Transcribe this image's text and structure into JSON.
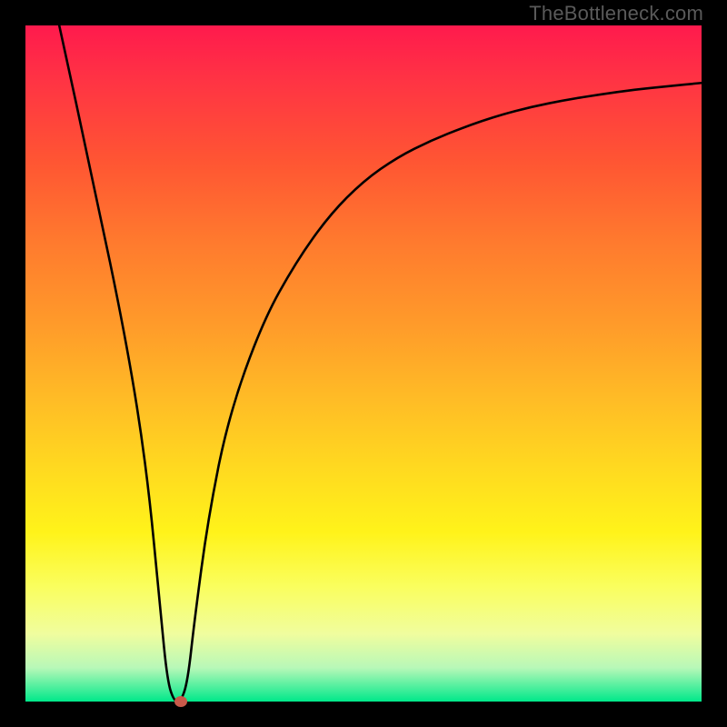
{
  "watermark": "TheBottleneck.com",
  "chart_data": {
    "type": "line",
    "title": "",
    "xlabel": "",
    "ylabel": "",
    "xlim": [
      0,
      100
    ],
    "ylim": [
      0,
      100
    ],
    "grid": false,
    "legend": false,
    "series": [
      {
        "name": "curve",
        "x": [
          5,
          10,
          15,
          18,
          20,
          21,
          22,
          23,
          24,
          25,
          27,
          30,
          35,
          40,
          45,
          50,
          55,
          60,
          65,
          70,
          75,
          80,
          85,
          90,
          95,
          100
        ],
        "values": [
          100,
          77,
          53,
          34,
          13,
          3,
          0,
          0,
          3,
          12,
          27,
          42,
          56,
          65,
          72,
          77,
          80.5,
          83,
          85,
          86.7,
          88,
          89,
          89.8,
          90.5,
          91,
          91.5
        ]
      }
    ],
    "marker": {
      "x": 23,
      "y": 0,
      "color": "#c85a4a"
    },
    "background_gradient": {
      "top": "#ff1a4d",
      "bottom": "#00e88a"
    }
  }
}
